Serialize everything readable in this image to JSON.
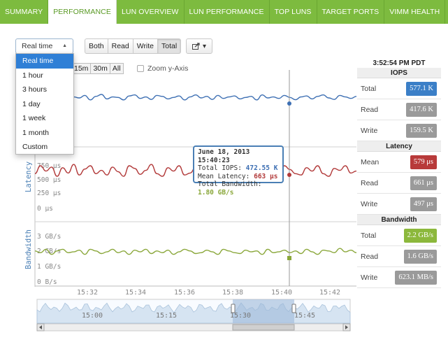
{
  "nav": {
    "tabs": [
      {
        "label": "SUMMARY",
        "active": false
      },
      {
        "label": "PERFORMANCE",
        "active": true
      },
      {
        "label": "LUN OVERVIEW",
        "active": false
      },
      {
        "label": "LUN PERFORMANCE",
        "active": false
      },
      {
        "label": "TOP LUNS",
        "active": false
      },
      {
        "label": "TARGET PORTS",
        "active": false
      },
      {
        "label": "VIMM HEALTH",
        "active": false
      }
    ]
  },
  "controls": {
    "time_select": "Real time",
    "io_filter": [
      "Both",
      "Read",
      "Write",
      "Total"
    ],
    "io_filter_selected": "Total",
    "export_icon": "export-icon",
    "range_buttons": [
      "15m",
      "30m",
      "All"
    ],
    "zoom_label": "Zoom y-Axis",
    "zoom_checked": false
  },
  "dropdown": {
    "items": [
      "Real time",
      "1 hour",
      "3 hours",
      "1 day",
      "1 week",
      "1 month",
      "Custom"
    ],
    "selected": "Real time"
  },
  "tooltip": {
    "date": "June 18, 2013 15:40:23",
    "iops_label": "Total IOPS:",
    "iops_value": "472.55 K",
    "latency_label": "Mean Latency:",
    "latency_value": "663 μs",
    "bandwidth_label": "Total Bandwidth:",
    "bandwidth_value": "1.80 GB/s"
  },
  "stats": {
    "time": "3:52:54 PM PDT",
    "iops": {
      "title": "IOPS",
      "rows": [
        {
          "label": "Total",
          "value": "577.1 K"
        },
        {
          "label": "Read",
          "value": "417.6 K"
        },
        {
          "label": "Write",
          "value": "159.5 K"
        }
      ]
    },
    "latency": {
      "title": "Latency",
      "rows": [
        {
          "label": "Mean",
          "value": "579 μs"
        },
        {
          "label": "Read",
          "value": "661 μs"
        },
        {
          "label": "Write",
          "value": "497 μs"
        }
      ]
    },
    "bandwidth": {
      "title": "Bandwidth",
      "rows": [
        {
          "label": "Total",
          "value": "2.2 GB/s"
        },
        {
          "label": "Read",
          "value": "1.6 GB/s"
        },
        {
          "label": "Write",
          "value": "623.1 MB/s"
        }
      ]
    }
  },
  "colors": {
    "iops": "#3d6fb3",
    "latency": "#b23a3a",
    "bandwidth": "#8aa73a",
    "nav": "#7dbb3f",
    "navigator_fill": "#c8dbee"
  },
  "chart_data": {
    "type": "line",
    "x_ticks": [
      "15:32",
      "15:34",
      "15:36",
      "15:38",
      "15:40",
      "15:42"
    ],
    "navigator_ticks": [
      "15:00",
      "15:15",
      "15:30",
      "15:45"
    ],
    "panels": [
      {
        "name": "IOPS",
        "ylabel": "",
        "series": [
          {
            "color": "#3d6fb3",
            "values": [
              505,
              470,
              520,
              480,
              495,
              510,
              475,
              500,
              490,
              515,
              470,
              505,
              525,
              480,
              500,
              495,
              470,
              510,
              520,
              485,
              500,
              475,
              515,
              505,
              480,
              495,
              510,
              470,
              500,
              520,
              490,
              505,
              475,
              515,
              485,
              500,
              510,
              480,
              495,
              505,
              470,
              520,
              490,
              500,
              485,
              515,
              495,
              472,
              500,
              510,
              480,
              505,
              520,
              490,
              475,
              515,
              500,
              485,
              505
            ]
          }
        ]
      },
      {
        "name": "Latency",
        "ylabel": "Latency",
        "y_ticks": [
          "0 μs",
          "250 μs",
          "500 μs",
          "750 μs"
        ],
        "series": [
          {
            "color": "#b23a3a",
            "values": [
              600,
              720,
              640,
              700,
              560,
              690,
              610,
              740,
              580,
              670,
              720,
              600,
              650,
              580,
              700,
              630,
              560,
              720,
              680,
              590,
              650,
              740,
              600,
              560,
              690,
              640,
              720,
              580,
              610,
              700,
              660,
              590,
              730,
              620,
              560,
              680,
              720,
              600,
              640,
              700,
              580,
              650,
              610,
              690,
              560,
              720,
              663,
              600,
              580,
              690,
              640,
              720,
              600,
              560,
              680,
              650,
              720,
              610,
              640
            ]
          }
        ]
      },
      {
        "name": "Bandwidth",
        "ylabel": "Bandwidth",
        "y_ticks": [
          "0 B/s",
          "1 GB/s",
          "2 GB/s",
          "3 GB/s"
        ],
        "series": [
          {
            "color": "#8aa73a",
            "values": [
              1.9,
              1.8,
              2.0,
              1.7,
              1.9,
              2.0,
              1.8,
              1.85,
              1.95,
              1.7,
              2.0,
              1.9,
              1.75,
              1.85,
              2.0,
              1.8,
              1.9,
              1.7,
              1.95,
              1.85,
              2.0,
              1.75,
              1.9,
              1.8,
              1.95,
              1.7,
              1.85,
              2.0,
              1.9,
              1.75,
              1.8,
              1.95,
              1.85,
              1.7,
              2.0,
              1.9,
              1.8,
              1.75,
              1.95,
              1.85,
              1.9,
              1.7,
              2.0,
              1.8,
              1.85,
              1.95,
              1.8,
              1.9,
              1.75,
              2.0,
              1.85,
              1.7,
              1.95,
              1.9,
              1.8,
              2.05,
              1.85,
              1.95,
              1.8
            ]
          }
        ]
      }
    ]
  }
}
